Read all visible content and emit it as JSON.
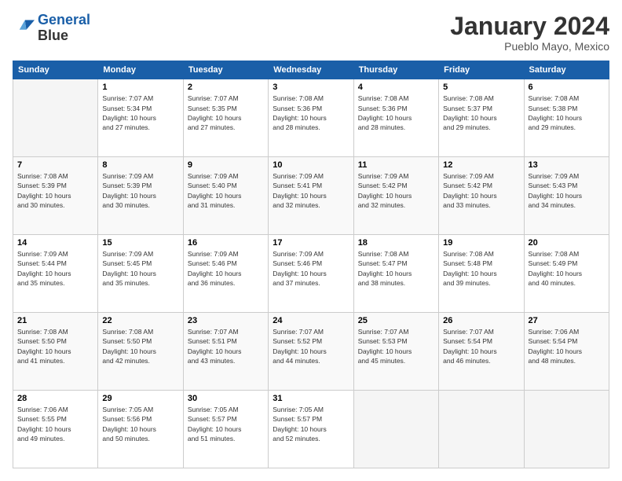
{
  "logo": {
    "line1": "General",
    "line2": "Blue"
  },
  "title": "January 2024",
  "subtitle": "Pueblo Mayo, Mexico",
  "weekdays": [
    "Sunday",
    "Monday",
    "Tuesday",
    "Wednesday",
    "Thursday",
    "Friday",
    "Saturday"
  ],
  "weeks": [
    [
      {
        "num": "",
        "info": ""
      },
      {
        "num": "1",
        "info": "Sunrise: 7:07 AM\nSunset: 5:34 PM\nDaylight: 10 hours\nand 27 minutes."
      },
      {
        "num": "2",
        "info": "Sunrise: 7:07 AM\nSunset: 5:35 PM\nDaylight: 10 hours\nand 27 minutes."
      },
      {
        "num": "3",
        "info": "Sunrise: 7:08 AM\nSunset: 5:36 PM\nDaylight: 10 hours\nand 28 minutes."
      },
      {
        "num": "4",
        "info": "Sunrise: 7:08 AM\nSunset: 5:36 PM\nDaylight: 10 hours\nand 28 minutes."
      },
      {
        "num": "5",
        "info": "Sunrise: 7:08 AM\nSunset: 5:37 PM\nDaylight: 10 hours\nand 29 minutes."
      },
      {
        "num": "6",
        "info": "Sunrise: 7:08 AM\nSunset: 5:38 PM\nDaylight: 10 hours\nand 29 minutes."
      }
    ],
    [
      {
        "num": "7",
        "info": "Sunrise: 7:08 AM\nSunset: 5:39 PM\nDaylight: 10 hours\nand 30 minutes."
      },
      {
        "num": "8",
        "info": "Sunrise: 7:09 AM\nSunset: 5:39 PM\nDaylight: 10 hours\nand 30 minutes."
      },
      {
        "num": "9",
        "info": "Sunrise: 7:09 AM\nSunset: 5:40 PM\nDaylight: 10 hours\nand 31 minutes."
      },
      {
        "num": "10",
        "info": "Sunrise: 7:09 AM\nSunset: 5:41 PM\nDaylight: 10 hours\nand 32 minutes."
      },
      {
        "num": "11",
        "info": "Sunrise: 7:09 AM\nSunset: 5:42 PM\nDaylight: 10 hours\nand 32 minutes."
      },
      {
        "num": "12",
        "info": "Sunrise: 7:09 AM\nSunset: 5:42 PM\nDaylight: 10 hours\nand 33 minutes."
      },
      {
        "num": "13",
        "info": "Sunrise: 7:09 AM\nSunset: 5:43 PM\nDaylight: 10 hours\nand 34 minutes."
      }
    ],
    [
      {
        "num": "14",
        "info": "Sunrise: 7:09 AM\nSunset: 5:44 PM\nDaylight: 10 hours\nand 35 minutes."
      },
      {
        "num": "15",
        "info": "Sunrise: 7:09 AM\nSunset: 5:45 PM\nDaylight: 10 hours\nand 35 minutes."
      },
      {
        "num": "16",
        "info": "Sunrise: 7:09 AM\nSunset: 5:46 PM\nDaylight: 10 hours\nand 36 minutes."
      },
      {
        "num": "17",
        "info": "Sunrise: 7:09 AM\nSunset: 5:46 PM\nDaylight: 10 hours\nand 37 minutes."
      },
      {
        "num": "18",
        "info": "Sunrise: 7:08 AM\nSunset: 5:47 PM\nDaylight: 10 hours\nand 38 minutes."
      },
      {
        "num": "19",
        "info": "Sunrise: 7:08 AM\nSunset: 5:48 PM\nDaylight: 10 hours\nand 39 minutes."
      },
      {
        "num": "20",
        "info": "Sunrise: 7:08 AM\nSunset: 5:49 PM\nDaylight: 10 hours\nand 40 minutes."
      }
    ],
    [
      {
        "num": "21",
        "info": "Sunrise: 7:08 AM\nSunset: 5:50 PM\nDaylight: 10 hours\nand 41 minutes."
      },
      {
        "num": "22",
        "info": "Sunrise: 7:08 AM\nSunset: 5:50 PM\nDaylight: 10 hours\nand 42 minutes."
      },
      {
        "num": "23",
        "info": "Sunrise: 7:07 AM\nSunset: 5:51 PM\nDaylight: 10 hours\nand 43 minutes."
      },
      {
        "num": "24",
        "info": "Sunrise: 7:07 AM\nSunset: 5:52 PM\nDaylight: 10 hours\nand 44 minutes."
      },
      {
        "num": "25",
        "info": "Sunrise: 7:07 AM\nSunset: 5:53 PM\nDaylight: 10 hours\nand 45 minutes."
      },
      {
        "num": "26",
        "info": "Sunrise: 7:07 AM\nSunset: 5:54 PM\nDaylight: 10 hours\nand 46 minutes."
      },
      {
        "num": "27",
        "info": "Sunrise: 7:06 AM\nSunset: 5:54 PM\nDaylight: 10 hours\nand 48 minutes."
      }
    ],
    [
      {
        "num": "28",
        "info": "Sunrise: 7:06 AM\nSunset: 5:55 PM\nDaylight: 10 hours\nand 49 minutes."
      },
      {
        "num": "29",
        "info": "Sunrise: 7:05 AM\nSunset: 5:56 PM\nDaylight: 10 hours\nand 50 minutes."
      },
      {
        "num": "30",
        "info": "Sunrise: 7:05 AM\nSunset: 5:57 PM\nDaylight: 10 hours\nand 51 minutes."
      },
      {
        "num": "31",
        "info": "Sunrise: 7:05 AM\nSunset: 5:57 PM\nDaylight: 10 hours\nand 52 minutes."
      },
      {
        "num": "",
        "info": ""
      },
      {
        "num": "",
        "info": ""
      },
      {
        "num": "",
        "info": ""
      }
    ]
  ]
}
